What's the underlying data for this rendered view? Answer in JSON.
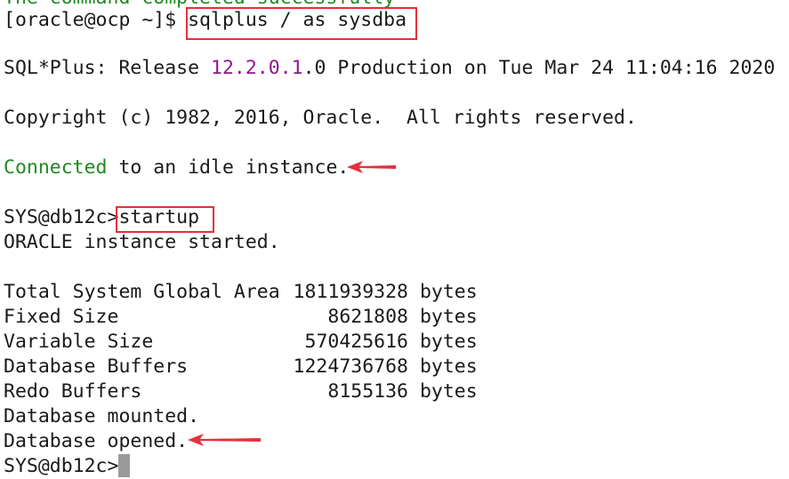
{
  "terminal": {
    "prev_line": "The command completed successfully",
    "prompt_host": "[oracle@ocp ~]$ ",
    "command1": "sqlplus / as sysdba",
    "banner_pre": "SQL*Plus: Release ",
    "banner_version": "12.2.0.1",
    "banner_post": ".0 Production on Tue Mar 24 11:04:16 2020",
    "copyright": "Copyright (c) 1982, 2016, Oracle.  All rights reserved.",
    "connected_word": "Connected",
    "connected_rest": " to an idle instance.",
    "sql_prompt": "SYS@db12c>",
    "command2": "startup",
    "instance_started": "ORACLE instance started.",
    "sga_rows": [
      {
        "label": "Total System Global Area",
        "value": "1811939328",
        "unit": "bytes"
      },
      {
        "label": "Fixed Size",
        "value": "8621808",
        "unit": "bytes"
      },
      {
        "label": "Variable Size",
        "value": "570425616",
        "unit": "bytes"
      },
      {
        "label": "Database Buffers",
        "value": "1224736768",
        "unit": "bytes"
      },
      {
        "label": "Redo Buffers",
        "value": "8155136",
        "unit": "bytes"
      }
    ],
    "db_mounted": "Database mounted.",
    "db_opened": "Database opened.",
    "final_prompt": "SYS@db12c>"
  },
  "colors": {
    "highlight_box": "#e5303b",
    "connected_green": "#1f8a1f",
    "version_purple": "#8b1a8b",
    "cursor_gray": "#9a9a9a"
  }
}
